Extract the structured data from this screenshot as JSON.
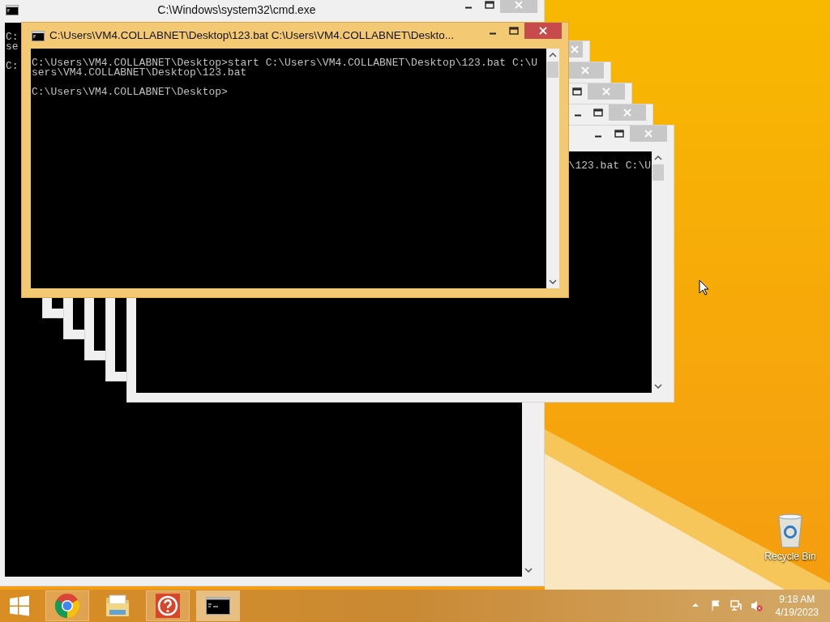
{
  "windows": [
    {
      "kind": "console",
      "title": "C:\\Windows\\system32\\cmd.exe",
      "active": false,
      "blocks": [
        [
          "C:",
          "se"
        ],
        [
          "C:"
        ]
      ]
    },
    {
      "kind": "console",
      "active": false
    },
    {
      "kind": "console",
      "active": false
    },
    {
      "kind": "console",
      "active": false
    },
    {
      "kind": "console",
      "active": false
    },
    {
      "kind": "console",
      "active": false,
      "blocks": [
        [
          "\\123.bat C:\\U"
        ]
      ]
    },
    {
      "kind": "console",
      "title": "C:\\Users\\VM4.COLLABNET\\Desktop\\123.bat   C:\\Users\\VM4.COLLABNET\\Deskto...",
      "active": true,
      "blocks": [
        [
          "C:\\Users\\VM4.COLLABNET\\Desktop>start C:\\Users\\VM4.COLLABNET\\Desktop\\123.bat C:\\U",
          "sers\\VM4.COLLABNET\\Desktop\\123.bat"
        ],
        [
          "C:\\Users\\VM4.COLLABNET\\Desktop>"
        ]
      ]
    }
  ],
  "desktop_icons": [
    {
      "kind": "recycle-bin",
      "label": "Recycle Bin"
    }
  ],
  "taskbar": {
    "buttons": [
      {
        "kind": "chrome",
        "running": true,
        "selected": false
      },
      {
        "kind": "explorer",
        "running": false,
        "selected": false
      },
      {
        "kind": "help",
        "running": true,
        "selected": false
      },
      {
        "kind": "console",
        "running": true,
        "selected": true
      }
    ],
    "time": "9:18 AM",
    "date": "4/19/2023"
  }
}
